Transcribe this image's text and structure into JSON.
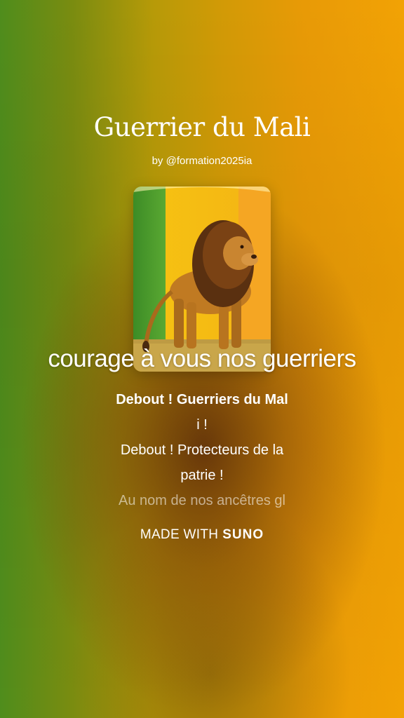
{
  "song": {
    "title": "Guerrier du Mali",
    "byline": "by @formation2025ia",
    "cover_art": "lion-on-mali-flag"
  },
  "caption": "courage à vous nos guerriers",
  "lyrics": [
    {
      "text": "Debout ! Guerriers du Mal",
      "state": "active"
    },
    {
      "text": "i !",
      "state": "normal"
    },
    {
      "text": "Debout ! Protecteurs de la",
      "state": "normal"
    },
    {
      "text": "patrie !",
      "state": "normal"
    },
    {
      "text": "Au nom de nos ancêtres gl",
      "state": "fading"
    }
  ],
  "footer": {
    "made_with": "MADE WITH",
    "brand": "SUNO"
  },
  "colors": {
    "flag_green": "#4aa02c",
    "flag_yellow": "#f6c412",
    "flag_red_orange": "#f5a623"
  }
}
